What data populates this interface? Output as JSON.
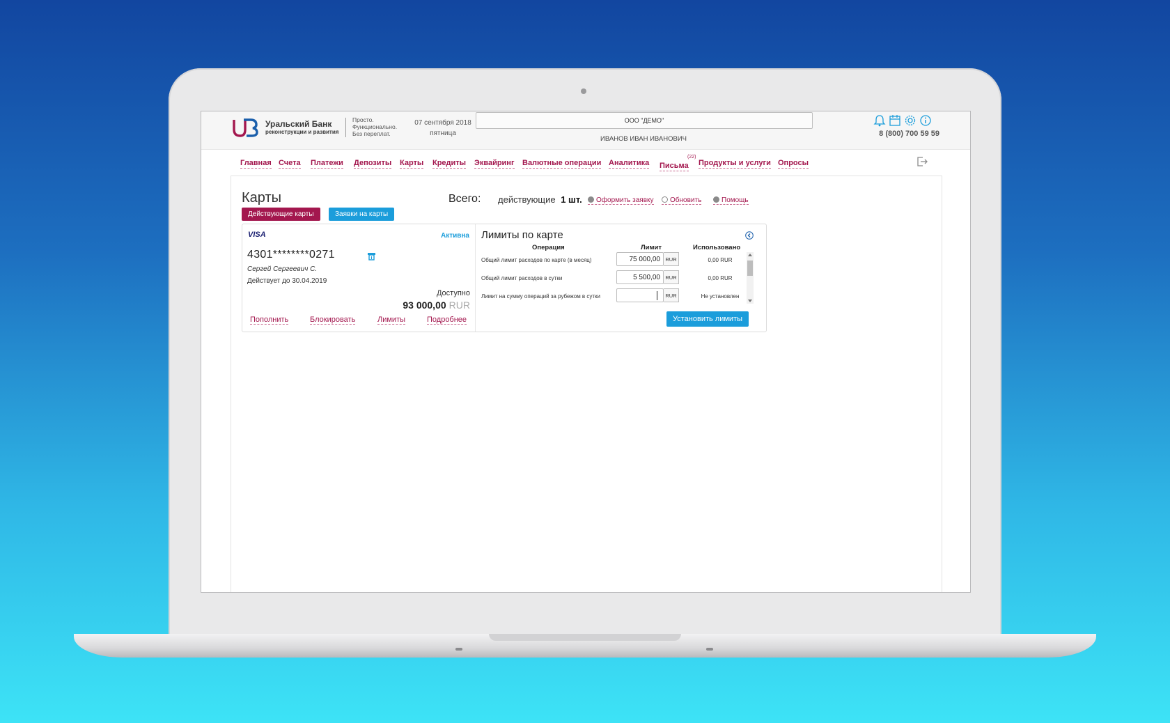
{
  "header": {
    "bank_name": "Уральский Банк",
    "bank_subtitle": "реконструкции и развития",
    "slogan": [
      "Просто.",
      "Функционально.",
      "Без переплат."
    ],
    "date": "07 сентября 2018",
    "weekday": "пятница",
    "organization": "ООО \"ДЕМО\"",
    "user_name": "ИВАНОВ ИВАН ИВАНОВИЧ",
    "phone": "8 (800) 700 59 59",
    "icons": [
      "bell-icon",
      "calendar-icon",
      "gear-icon",
      "info-icon"
    ]
  },
  "nav": {
    "items": [
      "Главная",
      "Счета",
      "Платежи",
      "Депозиты",
      "Карты",
      "Кредиты",
      "Эквайринг",
      "Валютные операции",
      "Аналитика",
      "Письма",
      "Продукты и услуги",
      "Опросы"
    ],
    "letters_badge": "(22)"
  },
  "page": {
    "title": "Карты",
    "tab_active": "Действующие карты",
    "tab_requests": "Заявки на карты",
    "total_label": "Всего:",
    "total_text": "действующие",
    "total_count": "1 шт.",
    "actions": {
      "apply": "Оформить заявку",
      "refresh": "Обновить",
      "help": "Помощь"
    }
  },
  "card": {
    "brand": "VISA",
    "status": "Активна",
    "number": "4301********0271",
    "holder": "Сергей Сергеевич С.",
    "valid_until": "Действует до 30.04.2019",
    "available_label": "Доступно",
    "available_amount": "93 000,00",
    "available_currency": "RUR",
    "actions": {
      "topup": "Пополнить",
      "block": "Блокировать",
      "limits": "Лимиты",
      "details": "Подробнее"
    }
  },
  "limits": {
    "title": "Лимиты по карте",
    "col_operation": "Операция",
    "col_limit": "Лимит",
    "col_used": "Использовано",
    "rows": [
      {
        "operation": "Общий лимит расходов по карте (в месяц)",
        "limit": "75 000,00",
        "currency": "RUR",
        "used": "0,00 RUR"
      },
      {
        "operation": "Общий лимит расходов в сутки",
        "limit": "5 500,00",
        "currency": "RUR",
        "used": "0,00 RUR"
      },
      {
        "operation": "Лимит на сумму операций за рубежом в сутки",
        "limit": "",
        "currency": "RUR",
        "used": "Не установлен"
      }
    ],
    "submit_label": "Установить лимиты"
  },
  "colors": {
    "brand_crimson": "#a3174e",
    "accent_blue": "#1b9ddb"
  }
}
